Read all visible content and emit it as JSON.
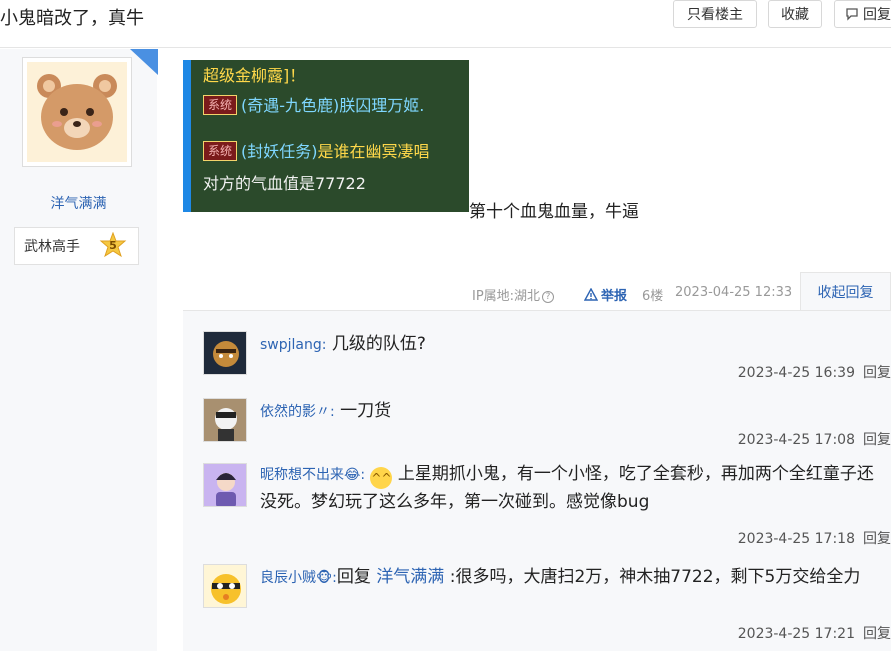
{
  "header": {
    "thread_title": "小鬼暗改了，真牛",
    "only_op_label": "只看楼主",
    "favorite_label": "收藏",
    "reply_label": "回复"
  },
  "author": {
    "name": "洋气满满",
    "level_title": "武林高手",
    "level_num": "5"
  },
  "post": {
    "image_lines": {
      "line1": "超级金柳露]！",
      "tag": "系统",
      "line2": "(奇遇-九色鹿)朕囚理万姬.",
      "line3_a": "(封妖任务)",
      "line3_b": "是谁在幽冥凄唱",
      "line4": "对方的气血值是77722"
    },
    "text": "第十个血鬼血量，牛逼",
    "ip_location": "IP属地:湖北",
    "report_label": "举报",
    "floor": "6楼",
    "time": "2023-04-25 12:33",
    "collapse_label": "收起回复"
  },
  "replies": [
    {
      "user": "swpjlang:",
      "content": "几级的队伍?",
      "time": "2023-4-25 16:39",
      "reply_label": "回复"
    },
    {
      "user": "依然的影〃:",
      "content": "一刀货",
      "time": "2023-4-25 17:08",
      "reply_label": "回复"
    },
    {
      "user": "昵称想不出来😂:",
      "content": "上星期抓小鬼，有一个小怪，吃了全套秒，再加两个全红童子还没死。梦幻玩了这么多年，第一次碰到。感觉像bug",
      "time": "2023-4-25 17:18",
      "reply_label": "回复"
    },
    {
      "user": "良辰小贼🐵:",
      "content_prefix": "回复 ",
      "at_user": "洋气满满",
      "content": " :很多吗，大唐扫2万，神木抽7722，剩下5万交给全力",
      "time": "2023-4-25 17:21",
      "reply_label": "回复"
    }
  ],
  "colors": {
    "link": "#2d64b3",
    "accent_bar": "#1e88e5",
    "sidebar_bg": "#f7f8fa"
  }
}
